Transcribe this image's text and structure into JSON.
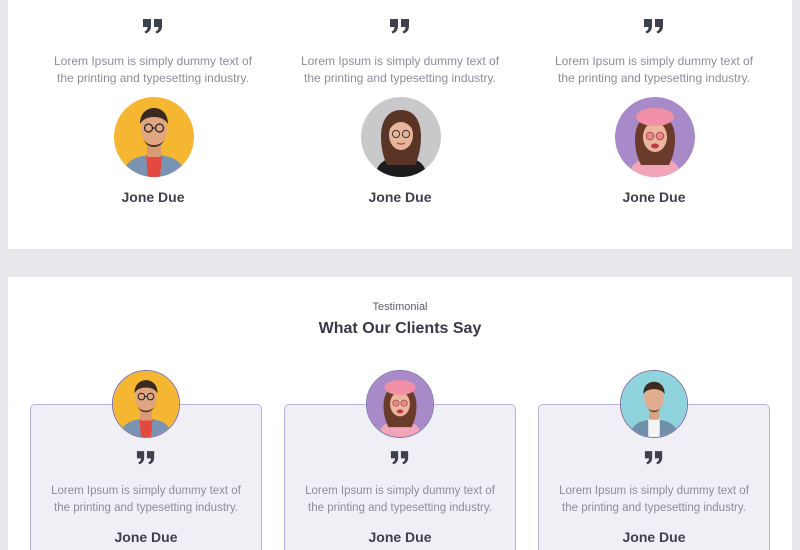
{
  "top_testimonials": [
    {
      "quote_icon": "quote-icon",
      "text_line1": "Lorem Ipsum is simply dummy text of",
      "text_line2": "the printing and typesetting industry.",
      "name": "Jone Due",
      "avatar": "man-with-glasses-yellow-bg"
    },
    {
      "quote_icon": "quote-icon",
      "text_line1": "Lorem Ipsum is simply dummy text of",
      "text_line2": "the printing and typesetting industry.",
      "name": "Jone Due",
      "avatar": "woman-with-glasses-grey-bg"
    },
    {
      "quote_icon": "quote-icon",
      "text_line1": "Lorem Ipsum is simply dummy text of",
      "text_line2": "the printing and typesetting industry.",
      "name": "Jone Due",
      "avatar": "woman-pink-beret-purple-bg"
    }
  ],
  "section": {
    "eyebrow": "Testimonial",
    "heading": "What Our Clients Say"
  },
  "cards": [
    {
      "text_line1": "Lorem Ipsum is simply dummy text of",
      "text_line2": "the printing and typesetting industry.",
      "name": "Jone Due",
      "avatar": "man-with-glasses-yellow-bg"
    },
    {
      "text_line1": "Lorem Ipsum is simply dummy text of",
      "text_line2": "the printing and typesetting industry.",
      "name": "Jone Due",
      "avatar": "woman-pink-beret-purple-bg"
    },
    {
      "text_line1": "Lorem Ipsum is simply dummy text of",
      "text_line2": "the printing and typesetting industry.",
      "name": "Jone Due",
      "avatar": "man-cyan-bg"
    }
  ],
  "colors": {
    "page_bg": "#e8e9ec",
    "card_bg": "#f0eff6",
    "card_border": "#b8b0d8",
    "text_muted": "#8b8e97",
    "text_dark": "#3d414b"
  }
}
